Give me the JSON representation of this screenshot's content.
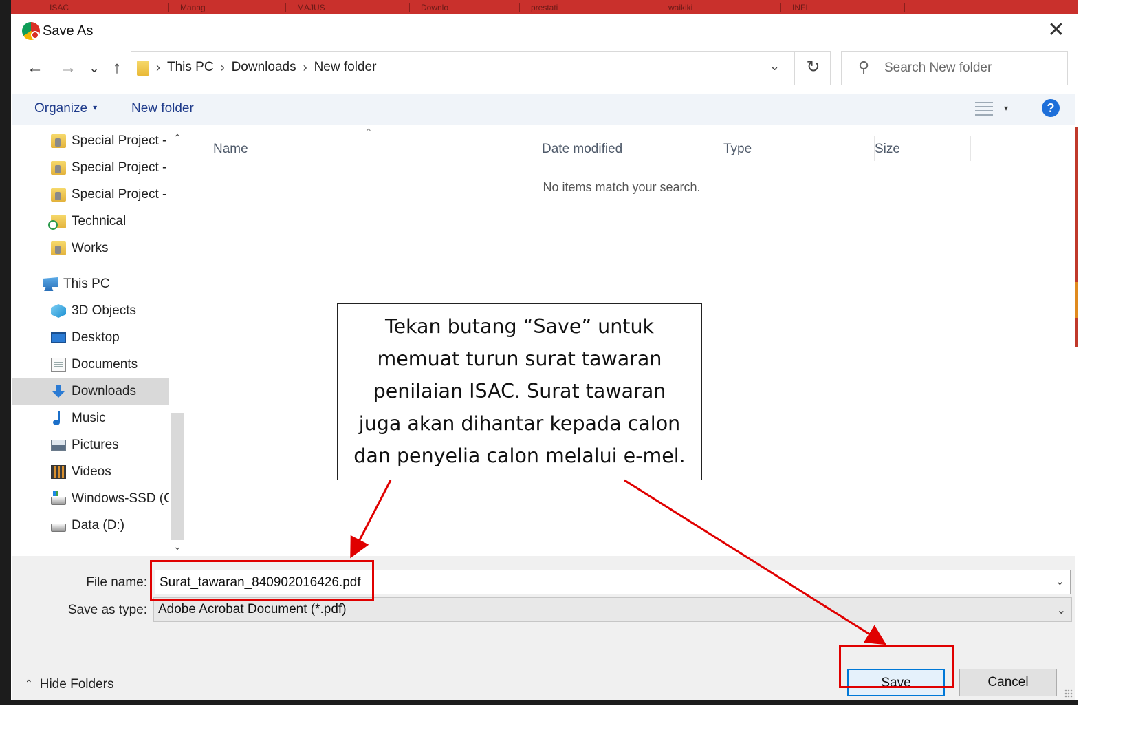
{
  "background_tabs": [
    "ISAC",
    "Manag",
    "MAJUS",
    "Downlo",
    "prestati",
    "waikiki",
    "INFI"
  ],
  "dialog": {
    "title": "Save As",
    "close_glyph": "✕"
  },
  "navigation": {
    "back_glyph": "←",
    "forward_glyph": "→",
    "recent_glyph": "⌄",
    "up_glyph": "↑",
    "breadcrumbs": [
      "This PC",
      "Downloads",
      "New folder"
    ],
    "breadcrumb_separator": "›",
    "dropdown_glyph": "⌄",
    "refresh_glyph": "↻",
    "search_placeholder": "Search New folder",
    "search_glyph": "⚲"
  },
  "command_bar": {
    "organize_label": "Organize",
    "caret_glyph": "▾",
    "new_folder_label": "New folder",
    "help_glyph": "?"
  },
  "nav_pane": {
    "items": [
      {
        "label": "Special Project -",
        "icon": "folder-icon"
      },
      {
        "label": "Special Project -",
        "icon": "folder-icon"
      },
      {
        "label": "Special Project -",
        "icon": "folder-icon"
      },
      {
        "label": "Technical",
        "icon": "synced-folder-icon"
      },
      {
        "label": "Works",
        "icon": "folder-icon"
      },
      {
        "label": "This PC",
        "icon": "this-pc-icon"
      },
      {
        "label": "3D Objects",
        "icon": "cube-icon"
      },
      {
        "label": "Desktop",
        "icon": "desktop-icon"
      },
      {
        "label": "Documents",
        "icon": "documents-icon"
      },
      {
        "label": "Downloads",
        "icon": "downloads-icon",
        "selected": true
      },
      {
        "label": "Music",
        "icon": "music-icon"
      },
      {
        "label": "Pictures",
        "icon": "pictures-icon"
      },
      {
        "label": "Videos",
        "icon": "videos-icon"
      },
      {
        "label": "Windows-SSD (C",
        "icon": "drive-icon"
      },
      {
        "label": "Data (D:)",
        "icon": "drive-icon"
      }
    ],
    "scroll_up_glyph": "⌃",
    "scroll_down_glyph": "⌄"
  },
  "file_list": {
    "columns": [
      "Name",
      "Date modified",
      "Type",
      "Size"
    ],
    "sort_glyph": "⌃",
    "empty_message": "No items match your search."
  },
  "form": {
    "file_name_label": "File name:",
    "file_name_value": "Surat_tawaran_840902016426.pdf",
    "save_as_type_label": "Save as type:",
    "save_as_type_value": "Adobe Acrobat Document (*.pdf)",
    "chevron_glyph": "⌄"
  },
  "footer": {
    "hide_folders_label": "Hide Folders",
    "hide_caret_glyph": "⌃",
    "save_label": "Save",
    "cancel_label": "Cancel"
  },
  "annotation": {
    "callout_lines": [
      "Tekan butang “Save” untuk",
      "memuat turun surat tawaran",
      "penilaian ISAC. Surat tawaran",
      "juga akan dihantar kepada calon",
      "dan penyelia calon melalui e-mel."
    ],
    "highlight_color": "#e00000"
  }
}
